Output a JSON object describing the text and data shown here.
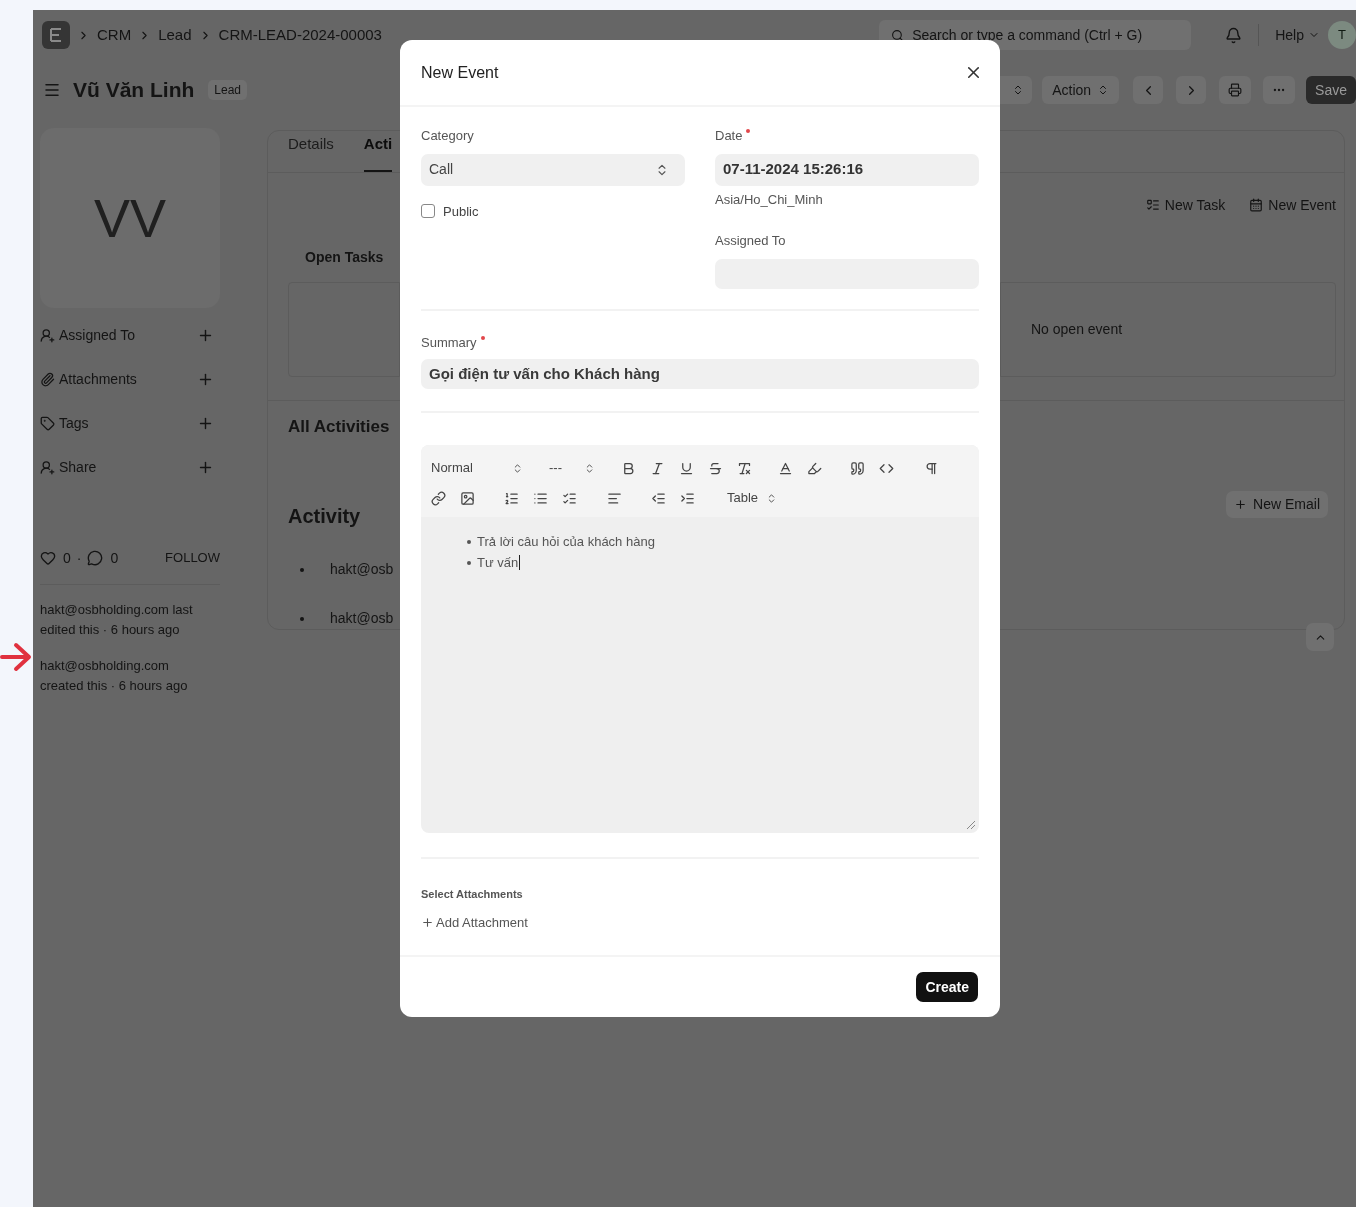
{
  "navbar": {
    "breadcrumbs": [
      "CRM",
      "Lead",
      "CRM-LEAD-2024-00003"
    ],
    "search": {
      "placeholder": "Search or type a command (Ctrl + G)"
    },
    "help": "Help",
    "avatar": "T"
  },
  "page_header": {
    "title": "Vũ Văn Linh",
    "badge": "Lead",
    "action": "Action",
    "save": "Save"
  },
  "sidebar": {
    "avatar_initials": "VV",
    "items": [
      {
        "label": "Assigned To"
      },
      {
        "label": "Attachments"
      },
      {
        "label": "Tags"
      },
      {
        "label": "Share"
      }
    ],
    "likes": "0",
    "separator": "·",
    "comments": "0",
    "follow": "FOLLOW",
    "history": [
      "hakt@osbholding.com last edited this · 6 hours ago",
      "hakt@osbholding.com created this · 6 hours ago"
    ]
  },
  "main": {
    "tabs": [
      {
        "label": "Details",
        "selected": false
      },
      {
        "label": "Acti",
        "selected": true
      }
    ],
    "open_tasks_title": "Open Tasks",
    "task_buttons": [
      "New Task",
      "New Event"
    ],
    "open_events_empty": "No open event",
    "all_activities_title": "All Activities",
    "activity_title": "Activity",
    "activity_items": [
      "hakt@osb",
      "hakt@osb"
    ],
    "new_email": "New Email"
  },
  "dialog": {
    "title": "New Event",
    "category": {
      "label": "Category",
      "value": "Call"
    },
    "public": {
      "label": "Public",
      "checked": false
    },
    "date": {
      "label": "Date",
      "required": true,
      "value": "07-11-2024 15:26:16",
      "timezone": "Asia/Ho_Chi_Minh"
    },
    "assigned_to": {
      "label": "Assigned To"
    },
    "summary": {
      "label": "Summary",
      "required": true,
      "value": "Gọi điện tư vấn cho Khách hàng"
    },
    "editor": {
      "style_select": "Normal",
      "size_select": "---",
      "table_select": "Table",
      "bullets": [
        "Trả lời câu hỏi của khách hàng",
        "Tư vấn"
      ]
    },
    "attachments": {
      "label": "Select Attachments",
      "add": "Add Attachment"
    },
    "create": "Create"
  }
}
